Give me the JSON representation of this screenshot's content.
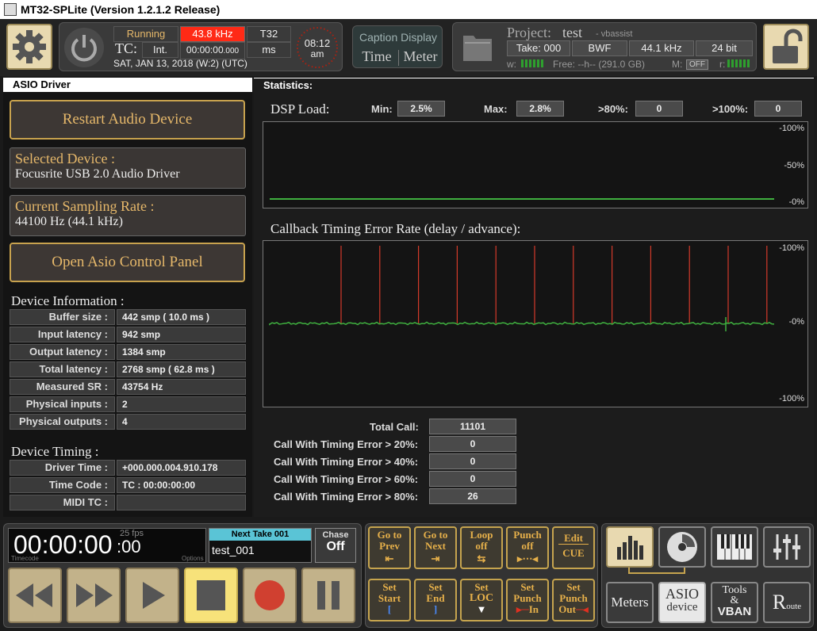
{
  "window": {
    "title": "MT32-SPLite (Version 1.2.1.2 Release)"
  },
  "status": {
    "state": "Running",
    "rate": "43.8 kHz",
    "model": "T32",
    "tc_label": "TC:",
    "tc_mode": "Int.",
    "tc_value": "00:00:00",
    "tc_ms": ".000",
    "tc_unit": "ms",
    "date": "SAT, JAN 13, 2018 (W:2) (UTC)",
    "clock_time": "08:12",
    "clock_ampm": "am"
  },
  "caption": {
    "title": "Caption Display",
    "time": "Time",
    "meter": "Meter"
  },
  "project": {
    "label": "Project:",
    "name": "test",
    "user": "- vbassist",
    "take": "Take: 000",
    "format": "BWF",
    "rate": "44.1 kHz",
    "bits": "24 bit",
    "w_label": "w:",
    "free": "Free: --h-- (291.0 GB)",
    "m_label": "M:",
    "m_value": "OFF",
    "r_label": "r:"
  },
  "asio": {
    "header": "ASIO Driver",
    "restart": "Restart Audio Device",
    "selected_title": "Selected Device :",
    "selected_value": "Focusrite USB 2.0 Audio Driver",
    "rate_title": "Current Sampling Rate :",
    "rate_value": "44100 Hz (44.1 kHz)",
    "open_panel": "Open Asio Control Panel",
    "info_title": "Device Information :",
    "info_rows": [
      {
        "label": "Buffer size :",
        "value": "442 smp ( 10.0 ms )"
      },
      {
        "label": "Input latency :",
        "value": "942 smp"
      },
      {
        "label": "Output latency :",
        "value": "1384 smp"
      },
      {
        "label": "Total latency :",
        "value": "2768 smp ( 62.8 ms )"
      },
      {
        "label": "Measured SR :",
        "value": "43754 Hz"
      },
      {
        "label": "Physical inputs :",
        "value": "2"
      },
      {
        "label": "Physical outputs :",
        "value": "4"
      }
    ],
    "timing_title": "Device Timing :",
    "timing_rows": [
      {
        "label": "Driver Time :",
        "value": "+000.000.004.910.178"
      },
      {
        "label": "Time Code :",
        "value": "TC : 00:00:00:00"
      },
      {
        "label": "MIDI TC :",
        "value": ""
      }
    ]
  },
  "stats": {
    "header": "Statistics:",
    "dsp_label": "DSP Load:",
    "min_label": "Min:",
    "min_value": "2.5%",
    "max_label": "Max:",
    "max_value": "2.8%",
    "gt80_label": ">80%:",
    "gt80_value": "0",
    "gt100_label": ">100%:",
    "gt100_value": "0",
    "dsp_axis": [
      "-100%",
      "-50%",
      "-0%"
    ],
    "dsp_load": 0.025,
    "cb_label": "Callback Timing Error Rate (delay / advance):",
    "cb_axis": [
      "-100%",
      "-0%",
      "-100%"
    ],
    "total_label": "Total Call:",
    "total_value": "11101",
    "err_rows": [
      {
        "label": "Call With Timing Error > 20%:",
        "value": "0"
      },
      {
        "label": "Call With Timing Error > 40%:",
        "value": "0"
      },
      {
        "label": "Call With Timing Error > 60%:",
        "value": "0"
      },
      {
        "label": "Call With Timing Error > 80%:",
        "value": "26"
      }
    ],
    "colors": {
      "signal": "#3fb03f",
      "error": "#d43a2a"
    }
  },
  "transport": {
    "time_main": "00:00:00",
    "time_frames": ":00",
    "fps": "25 fps",
    "tc_caption": "Timecode",
    "options_caption": "Options",
    "next_take_label": "Next Take 001",
    "take_name": "test_001",
    "chase_label": "Chase",
    "chase_value": "Off"
  },
  "buttons": {
    "goto_prev": [
      "Go to",
      "Prev"
    ],
    "goto_next": [
      "Go to",
      "Next"
    ],
    "loop": [
      "Loop",
      "off"
    ],
    "punch": [
      "Punch",
      "off"
    ],
    "edit": [
      "Edit",
      "CUE"
    ],
    "set_start": [
      "Set",
      "Start"
    ],
    "set_end": [
      "Set",
      "End"
    ],
    "set_loc": [
      "Set",
      "LOC"
    ],
    "set_punch_in": [
      "Set",
      "Punch",
      "In"
    ],
    "set_punch_out": [
      "Set",
      "Punch",
      "Out"
    ]
  },
  "nav": {
    "meters": "Meters",
    "asio_1": "ASIO",
    "asio_2": "device",
    "tools_1": "Tools",
    "tools_2": "&",
    "tools_3": "VBAN",
    "route_big": "R",
    "route_small": "oute"
  }
}
